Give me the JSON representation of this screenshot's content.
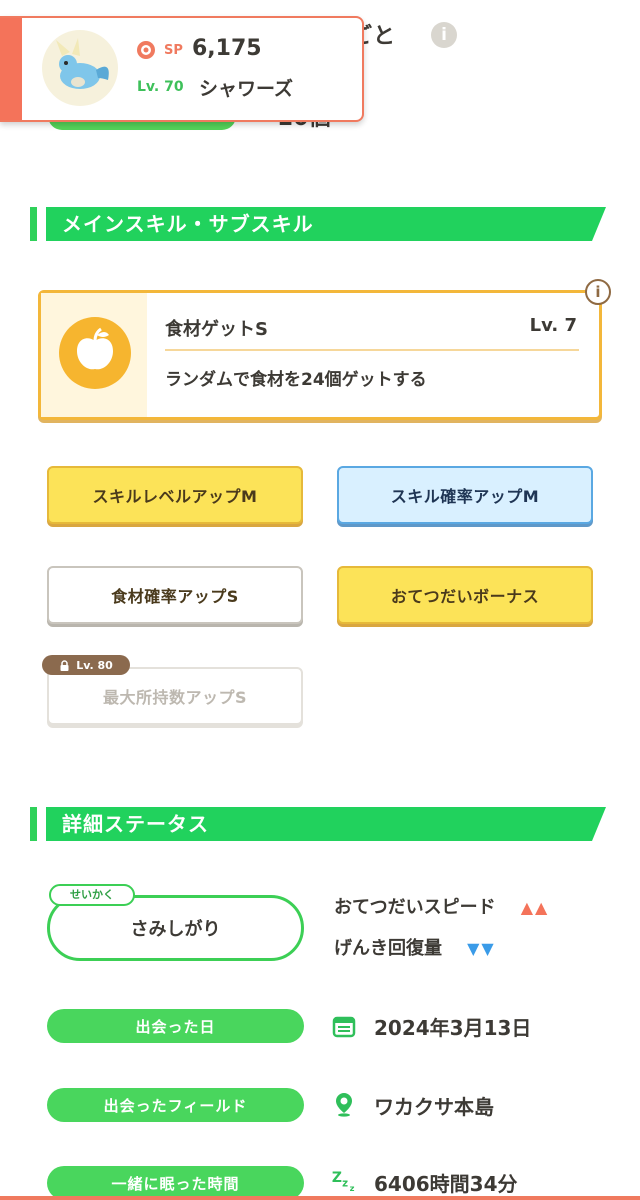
{
  "top": {
    "title_fragment": "ごと",
    "count_fragment": "20個"
  },
  "pokemon": {
    "sp_label": "SP",
    "sp_value": "6,175",
    "level": "Lv. 70",
    "name": "シャワーズ",
    "accent_color": "#f4735a"
  },
  "main_skill_section": {
    "title": "メインスキル・サブスキル"
  },
  "main_skill": {
    "name": "食材ゲットS",
    "level": "Lv. 7",
    "description": "ランダムで食材を24個ゲットする",
    "icon": "apple-icon"
  },
  "sub_skills": [
    {
      "label": "スキルレベルアップM",
      "style": "yellow"
    },
    {
      "label": "スキル確率アップM",
      "style": "blue"
    },
    {
      "label": "食材確率アップS",
      "style": "white"
    },
    {
      "label": "おてつだいボーナス",
      "style": "yellow"
    },
    {
      "label": "最大所持数アップS",
      "style": "locked",
      "unlock_level": "Lv. 80"
    }
  ],
  "detail_section": {
    "title": "詳細ステータス"
  },
  "nature": {
    "tag": "せいかく",
    "value": "さみしがり",
    "up_stat": "おてつだいスピード",
    "up_marks": "▲▲",
    "down_stat": "げんき回復量",
    "down_marks": "▼▼"
  },
  "details": [
    {
      "label": "出会った日",
      "value": "2024年3月13日",
      "icon": "calendar-icon"
    },
    {
      "label": "出会ったフィールド",
      "value": "ワカクサ本島",
      "icon": "location-pin-icon"
    },
    {
      "label": "一緒に眠った時間",
      "value": "6406時間34分",
      "icon": "sleep-zzz-icon"
    }
  ],
  "colors": {
    "green": "#21d25d",
    "orange": "#f4735a",
    "yellow": "#fce358",
    "blue": "#d9f0ff"
  }
}
